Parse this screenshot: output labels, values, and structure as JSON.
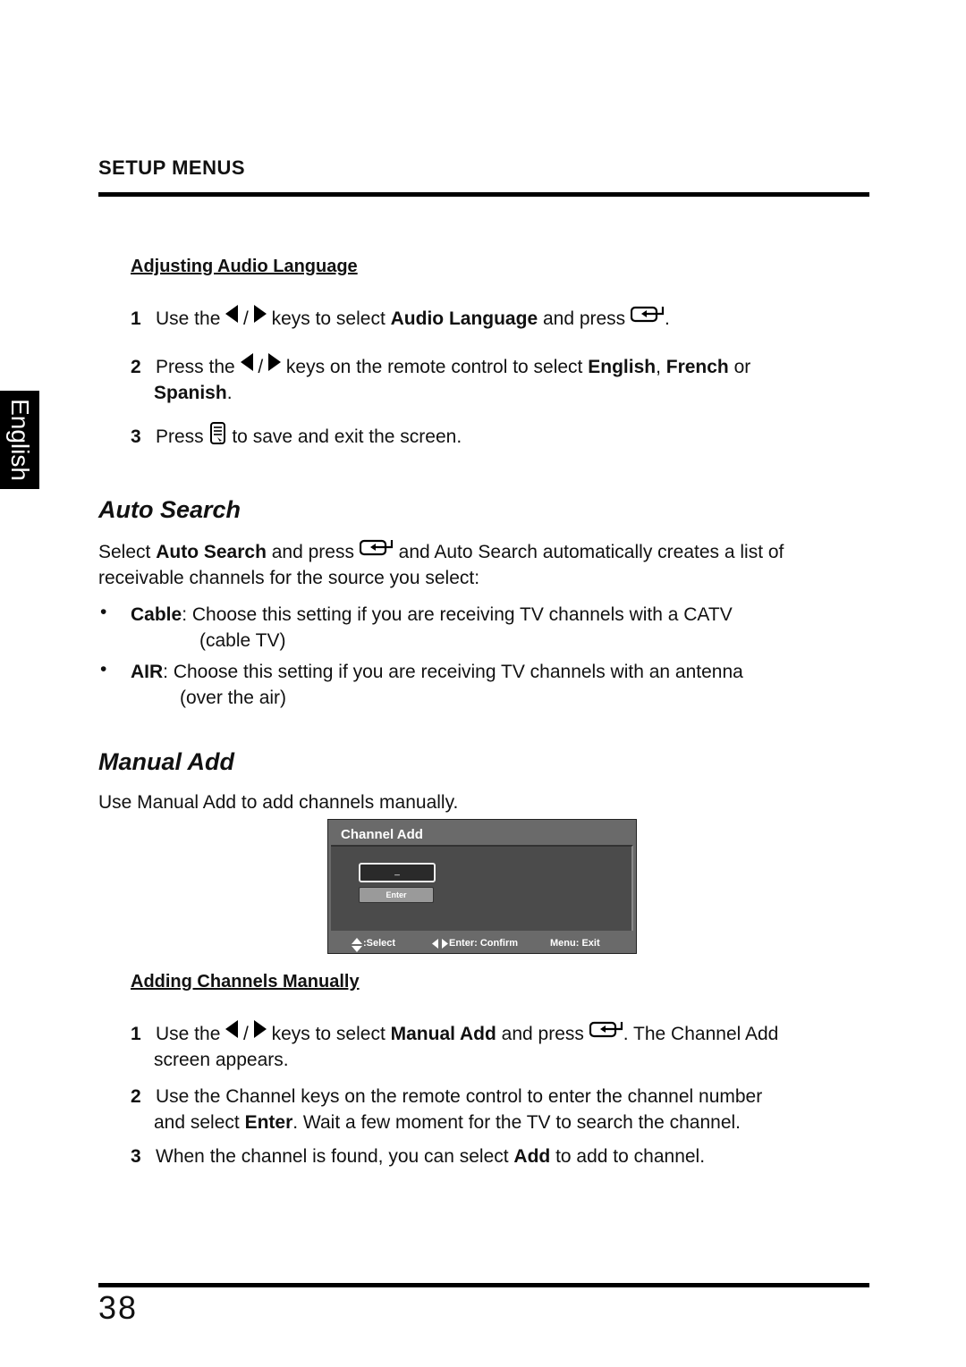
{
  "header": {
    "section_title": "SETUP MENUS"
  },
  "side_tab": {
    "label": "English"
  },
  "audio_language": {
    "subheading": "Adjusting Audio Language",
    "steps": [
      {
        "num": "1",
        "t1": "Use the ",
        "slash": " / ",
        "t2": " keys to select ",
        "b1": "Audio Language",
        "t3": " and press ",
        "t4": "."
      },
      {
        "num": "2",
        "t1": "Press the ",
        "slash": " / ",
        "t2": " keys on the remote control to select ",
        "b1": "English",
        "t3": ", ",
        "b2": "French",
        "t4": " or",
        "b3": "Spanish",
        "t5": "."
      },
      {
        "num": "3",
        "t1": "Press ",
        "t2": " to save and exit the screen."
      }
    ]
  },
  "auto_search": {
    "heading": "Auto Search",
    "p1": "Select ",
    "p1_bold": "Auto Search",
    "p2": " and press ",
    "p3": " and Auto Search automatically creates a list of",
    "p4": "receivable channels for the source you select:",
    "bullets": [
      {
        "bold": "Cable",
        "text": ": Choose this setting if you are receiving TV channels with a CATV",
        "cont": "(cable TV)"
      },
      {
        "bold": "AIR",
        "text": ": Choose this setting if you are receiving TV channels with an antenna",
        "cont": "(over the air)"
      }
    ]
  },
  "manual_add": {
    "heading": "Manual Add",
    "intro": "Use Manual Add to add channels manually.",
    "osd": {
      "title": "Channel Add",
      "input_value": "_",
      "enter_label": "Enter",
      "footer_select": ":Select",
      "footer_confirm": "Enter: Confirm",
      "footer_exit": "Menu: Exit"
    },
    "subheading": "Adding Channels Manually",
    "steps": [
      {
        "num": "1",
        "t1": "Use the ",
        "slash": " / ",
        "t2": " keys to select ",
        "b1": "Manual Add",
        "t3": " and press ",
        "t4": ". The Channel Add",
        "t5": "screen appears."
      },
      {
        "num": "2",
        "t1": "Use the Channel keys on the remote control to enter the channel number",
        "t2": "and select ",
        "b1": "Enter",
        "t3": ". Wait a few moment for the TV to search the channel."
      },
      {
        "num": "3",
        "t1": "When the channel is found, you can select ",
        "b1": "Add",
        "t2": " to add to channel."
      }
    ]
  },
  "footer": {
    "page_number": "38"
  }
}
